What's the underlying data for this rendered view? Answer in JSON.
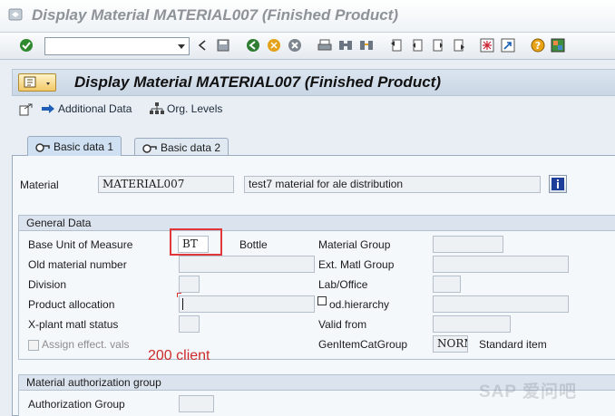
{
  "window": {
    "title": "Display Material MATERIAL007 (Finished Product)"
  },
  "system_toolbar": {
    "command_field_value": "",
    "icons": [
      "enter-icon",
      "back-icon",
      "save-icon",
      "back-arrow-icon",
      "exit-icon",
      "cancel-icon",
      "print-icon",
      "find-icon",
      "find-next-icon",
      "first-page-icon",
      "previous-page-icon",
      "next-page-icon",
      "last-page-icon",
      "create-session-icon",
      "shortcut-icon",
      "help-icon",
      "customize-layout-icon"
    ]
  },
  "app": {
    "title": "Display Material MATERIAL007 (Finished Product)",
    "toolbar": {
      "additional_data": "Additional Data",
      "org_levels": "Org. Levels"
    },
    "tabs": [
      {
        "label": "Basic data 1",
        "active": true
      },
      {
        "label": "Basic data 2",
        "active": false
      }
    ]
  },
  "material": {
    "label": "Material",
    "number": "MATERIAL007",
    "description": "test7 material for ale distribution"
  },
  "general_data": {
    "header": "General Data",
    "base_uom_label": "Base Unit of Measure",
    "base_uom_value": "BT",
    "base_uom_text": "Bottle",
    "old_material_label": "Old material number",
    "old_material_value": "",
    "division_label": "Division",
    "division_value": "",
    "product_allocation_label": "Product allocation",
    "product_allocation_value": "",
    "xplant_status_label": "X-plant matl status",
    "xplant_status_value": "",
    "assign_effect_label": "Assign effect. vals",
    "material_group_label": "Material Group",
    "material_group_value": "",
    "ext_matl_group_label": "Ext. Matl Group",
    "ext_matl_group_value": "",
    "lab_office_label": "Lab/Office",
    "lab_office_value": "",
    "prod_hierarchy_label": "od.hierarchy",
    "prod_hierarchy_value": "",
    "valid_from_label": "Valid from",
    "valid_from_value": "",
    "gen_item_cat_label": "GenItemCatGroup",
    "gen_item_cat_value": "NORM",
    "gen_item_cat_text": "Standard item"
  },
  "annotation": {
    "client_note": "200 client"
  },
  "auth_group": {
    "header": "Material authorization group",
    "label": "Authorization Group",
    "value": ""
  },
  "watermark": "SAP 爱问吧",
  "colors": {
    "highlight": "#e0383a",
    "annotation": "#cc2a2a",
    "title_gray": "#8d9399"
  }
}
